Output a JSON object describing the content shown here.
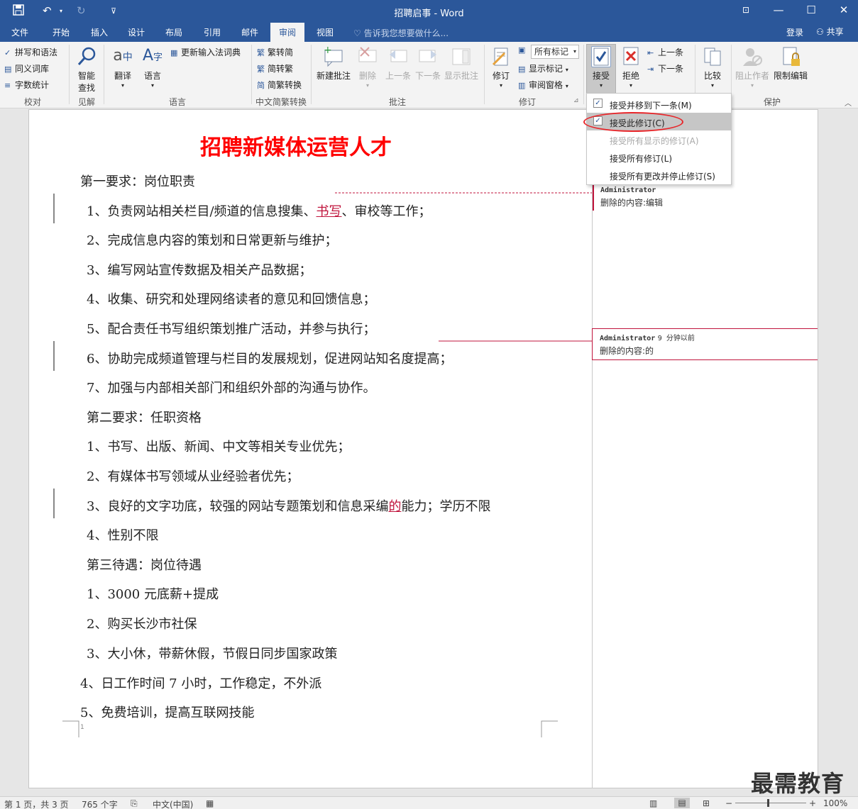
{
  "window": {
    "title": "招聘启事 - Word",
    "tell_me": "告诉我您想要做什么...",
    "login": "登录",
    "share": "共享"
  },
  "tabs": [
    "文件",
    "开始",
    "插入",
    "设计",
    "布局",
    "引用",
    "邮件",
    "审阅",
    "视图"
  ],
  "active_tab": "审阅",
  "ribbon": {
    "proofing": {
      "spelling": "拼写和语法",
      "thesaurus": "同义词库",
      "word_count": "字数统计",
      "label": "校对"
    },
    "insights": {
      "smart_lookup_1": "智能",
      "smart_lookup_2": "查找",
      "label": "见解"
    },
    "language": {
      "translate": "翻译",
      "language": "语言",
      "update_ime": "更新输入法词典",
      "label": "语言"
    },
    "chinese_conversion": {
      "to_simplified": "繁转简",
      "to_traditional": "简转繁",
      "convert": "简繁转换",
      "label": "中文简繁转换"
    },
    "comments": {
      "new": "新建批注",
      "delete": "删除",
      "previous": "上一条",
      "next": "下一条",
      "show": "显示批注",
      "label": "批注"
    },
    "tracking": {
      "track": "修订",
      "display_markup": "所有标记",
      "show_markup": "显示标记",
      "reviewing_pane": "审阅窗格",
      "label": "修订"
    },
    "changes": {
      "accept": "接受",
      "reject": "拒绝",
      "previous": "上一条",
      "next": "下一条"
    },
    "compare": {
      "compare": "比较"
    },
    "protect": {
      "block_authors": "阻止作者",
      "restrict_editing": "限制编辑",
      "label": "保护"
    }
  },
  "accept_menu": {
    "items": [
      {
        "label": "接受并移到下一条(M)",
        "enabled": true,
        "checkbox": true
      },
      {
        "label": "接受此修订(C)",
        "enabled": true,
        "checkbox": true,
        "highlighted": true
      },
      {
        "label": "接受所有显示的修订(A)",
        "enabled": false
      },
      {
        "label": "接受所有修订(L)",
        "enabled": true
      },
      {
        "label": "接受所有更改并停止修订(S)",
        "enabled": true
      }
    ]
  },
  "document": {
    "title": "招聘新媒体运营人才",
    "paragraphs": [
      "第一要求：岗位职责",
      "1、负责网站相关栏目/频道的信息搜集、",
      "2、完成信息内容的策划和日常更新与维护；",
      "3、编写网站宣传数据及相关产品数据；",
      "4、收集、研究和处理网络读者的意见和回馈信息；",
      "5、配合责任书写组织策划推广活动，并参与执行；",
      "6、协助完成频道管理与栏目的发展规划，促进网站知名度提高；",
      "7、加强与内部相关部门和组织外部的沟通与协作。",
      "第二要求：任职资格",
      "1、书写、出版、新闻、中文等相关专业优先；",
      "2、有媒体书写领域从业经验者优先；",
      "3、良好的文字功底，较强的网站专题策划和信息采编",
      "4、性别不限",
      "第三待遇：岗位待遇",
      "1、3000 元底薪+提成",
      "2、购买长沙市社保",
      "3、大小休，带薪休假，节假日同步国家政策",
      "4、日工作时间 7 小时，工作稳定，不外派",
      "5、免费培训，提高互联网技能"
    ],
    "p2_insert": "书写",
    "p2_tail": "、审校等工作；",
    "p12_insert": "的",
    "p12_tail": "能力；学历不限",
    "page_number_mark": "1"
  },
  "comments": [
    {
      "author": "Administrator",
      "time": "",
      "body": "删除的内容:编辑"
    },
    {
      "author": "Administrator",
      "time": "9 分钟以前",
      "body": "删除的内容:的"
    }
  ],
  "status": {
    "page": "第 1 页，共 3 页",
    "words": "765 个字",
    "language": "中文(中国)",
    "zoom": "100%"
  },
  "watermark": "最需教育",
  "colors": {
    "accent": "#2b579a",
    "title_red": "#ff0000",
    "revision": "#c0143c",
    "highlight_ellipse": "#e8262a"
  }
}
